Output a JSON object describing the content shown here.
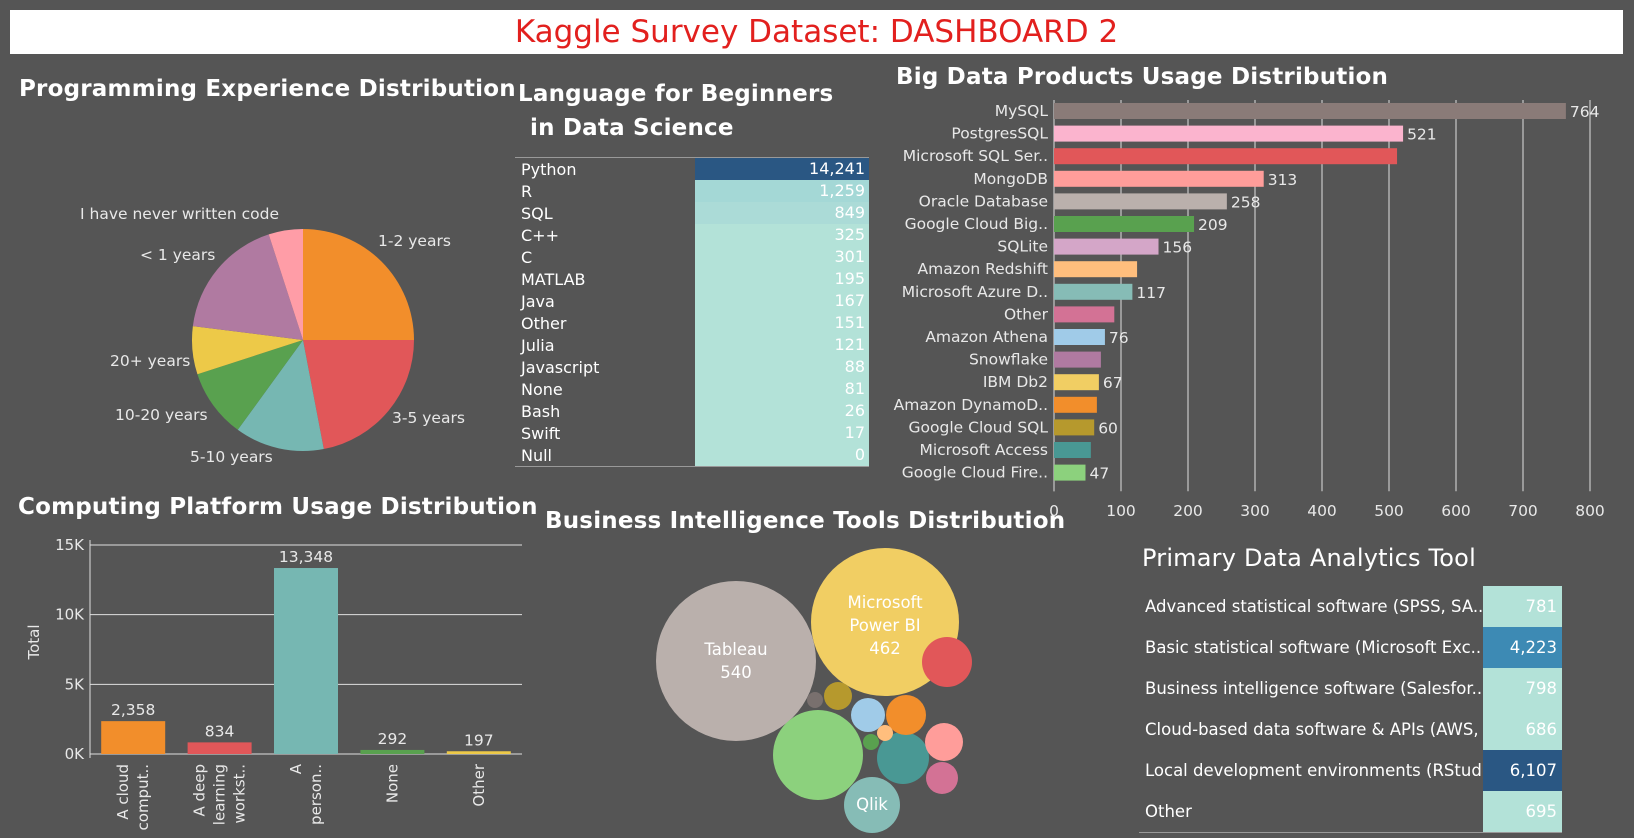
{
  "dashboard_title": "Kaggle Survey Dataset: DASHBOARD 2",
  "panels": {
    "programming": "Programming Experience Distribution",
    "language_line1": "Language for Beginners",
    "language_line2": "in Data Science",
    "bigdata": "Big Data Products Usage Distribution",
    "computing": "Computing Platform Usage Distribution",
    "bi": "Business Intelligence Tools Distribution",
    "analytics": "Primary Data Analytics Tool"
  },
  "chart_data": [
    {
      "id": "programming-experience",
      "type": "pie",
      "title": "Programming Experience Distribution",
      "labels": [
        "1-2 years",
        "3-5 years",
        "5-10 years",
        "10-20 years",
        "20+ years",
        "< 1 years",
        "I have never written code"
      ],
      "values": [
        25,
        22,
        13,
        10,
        7,
        18,
        5
      ],
      "colors": [
        "#f28e2b",
        "#e15759",
        "#76b7b2",
        "#59a14f",
        "#edc948",
        "#b07aa1",
        "#ff9da7"
      ]
    },
    {
      "id": "language-beginners",
      "type": "table",
      "title": "Language for Beginners in Data Science",
      "rows": [
        {
          "label": "Python",
          "value": "14,241",
          "color": "#2a5783"
        },
        {
          "label": "R",
          "value": "1,259",
          "color": "#a4d8d6"
        },
        {
          "label": "SQL",
          "value": "849",
          "color": "#abdbd7"
        },
        {
          "label": "C++",
          "value": "325",
          "color": "#b3e2d8"
        },
        {
          "label": "C",
          "value": "301",
          "color": "#b3e2d8"
        },
        {
          "label": "MATLAB",
          "value": "195",
          "color": "#b3e2d8"
        },
        {
          "label": "Java",
          "value": "167",
          "color": "#b3e2d8"
        },
        {
          "label": "Other",
          "value": "151",
          "color": "#b3e2d8"
        },
        {
          "label": "Julia",
          "value": "121",
          "color": "#b3e2d8"
        },
        {
          "label": "Javascript",
          "value": "88",
          "color": "#b3e2d8"
        },
        {
          "label": "None",
          "value": "81",
          "color": "#b3e2d8"
        },
        {
          "label": "Bash",
          "value": "26",
          "color": "#b3e2d8"
        },
        {
          "label": "Swift",
          "value": "17",
          "color": "#b3e2d8"
        },
        {
          "label": "Null",
          "value": "0",
          "color": "#b3e2d8"
        }
      ]
    },
    {
      "id": "big-data-products",
      "type": "bar",
      "orientation": "horizontal",
      "title": "Big Data Products Usage Distribution",
      "categories": [
        "MySQL",
        "PostgresSQL",
        "Microsoft SQL Ser..",
        "MongoDB",
        "Oracle Database",
        "Google Cloud Big..",
        "SQLite",
        "Amazon Redshift",
        "Microsoft Azure D..",
        "Other",
        "Amazon Athena",
        "Snowflake",
        "IBM Db2",
        "Amazon DynamoD..",
        "Google Cloud SQL",
        "Microsoft Access",
        "Google Cloud Fire.."
      ],
      "values": [
        764,
        521,
        512,
        313,
        258,
        209,
        156,
        124,
        117,
        90,
        76,
        70,
        67,
        64,
        60,
        55,
        47
      ],
      "labels": [
        "764",
        "521",
        "",
        "313",
        "258",
        "209",
        "156",
        "",
        "117",
        "",
        "76",
        "",
        "67",
        "",
        "60",
        "",
        "47"
      ],
      "colors": [
        "#8a7b78",
        "#fbb4ce",
        "#e15759",
        "#ff9d9a",
        "#bab0ac",
        "#59a14f",
        "#d4a6c8",
        "#ffbe7d",
        "#86bcb6",
        "#d37295",
        "#a0cbe8",
        "#b07aa1",
        "#f1ce63",
        "#f28e2b",
        "#b6992d",
        "#499894",
        "#8cd17d"
      ],
      "xlim": [
        0,
        800
      ],
      "xticks": [
        "0",
        "100",
        "200",
        "300",
        "400",
        "500",
        "600",
        "700",
        "800"
      ],
      "grid": true
    },
    {
      "id": "computing-platform",
      "type": "bar",
      "title": "Computing Platform Usage Distribution",
      "ylabel": "Total",
      "categories": [
        "A cloud comput..",
        "A deep learning workst..",
        "A person..",
        "None",
        "Other"
      ],
      "category_lines": [
        [
          "A cloud",
          "comput.."
        ],
        [
          "A deep",
          "learning",
          "workst.."
        ],
        [
          "A",
          "person.."
        ],
        [
          "None"
        ],
        [
          "Other"
        ]
      ],
      "values": [
        2358,
        834,
        13348,
        292,
        197
      ],
      "labels": [
        "2,358",
        "834",
        "13,348",
        "292",
        "197"
      ],
      "colors": [
        "#f28e2b",
        "#e15759",
        "#76b7b2",
        "#59a14f",
        "#edc948"
      ],
      "ylim": [
        0,
        15000
      ],
      "yticks": [
        "0K",
        "5K",
        "10K",
        "15K"
      ],
      "grid": true
    },
    {
      "id": "bi-tools",
      "type": "bubble",
      "title": "Business Intelligence Tools Distribution",
      "bubbles": [
        {
          "name": "Tableau",
          "value": "540",
          "color": "#bab0ac"
        },
        {
          "name": "Microsoft Power BI",
          "value": "462",
          "color": "#f1ce63"
        },
        {
          "name": "",
          "value": "",
          "color": "#8cd17d"
        },
        {
          "name": "Qlik",
          "value": "",
          "color": "#86bcb6"
        },
        {
          "name": "",
          "value": "",
          "color": "#e15759"
        },
        {
          "name": "",
          "value": "",
          "color": "#499894"
        },
        {
          "name": "",
          "value": "",
          "color": "#ff9d9a"
        },
        {
          "name": "",
          "value": "",
          "color": "#f28e2b"
        },
        {
          "name": "",
          "value": "",
          "color": "#d37295"
        },
        {
          "name": "",
          "value": "",
          "color": "#a0cbe8"
        },
        {
          "name": "",
          "value": "",
          "color": "#b6992d"
        },
        {
          "name": "",
          "value": "",
          "color": "#ffbe7d"
        },
        {
          "name": "",
          "value": "",
          "color": "#59a14f"
        },
        {
          "name": "",
          "value": "",
          "color": "#79706e"
        }
      ]
    },
    {
      "id": "primary-analytics-tool",
      "type": "table",
      "title": "Primary Data Analytics Tool",
      "rows": [
        {
          "label": "Advanced statistical software (SPSS, SA..",
          "value": "781",
          "color": "#b3e2d8"
        },
        {
          "label": "Basic statistical software (Microsoft Exc..",
          "value": "4,223",
          "color": "#3d8ab4"
        },
        {
          "label": "Business intelligence software (Salesfor..",
          "value": "798",
          "color": "#b3e2d8"
        },
        {
          "label": "Cloud-based data software & APIs (AWS, ..",
          "value": "686",
          "color": "#b3e2d8"
        },
        {
          "label": "Local development environments (RStud..",
          "value": "6,107",
          "color": "#2a5783"
        },
        {
          "label": "Other",
          "value": "695",
          "color": "#b3e2d8"
        }
      ]
    }
  ]
}
